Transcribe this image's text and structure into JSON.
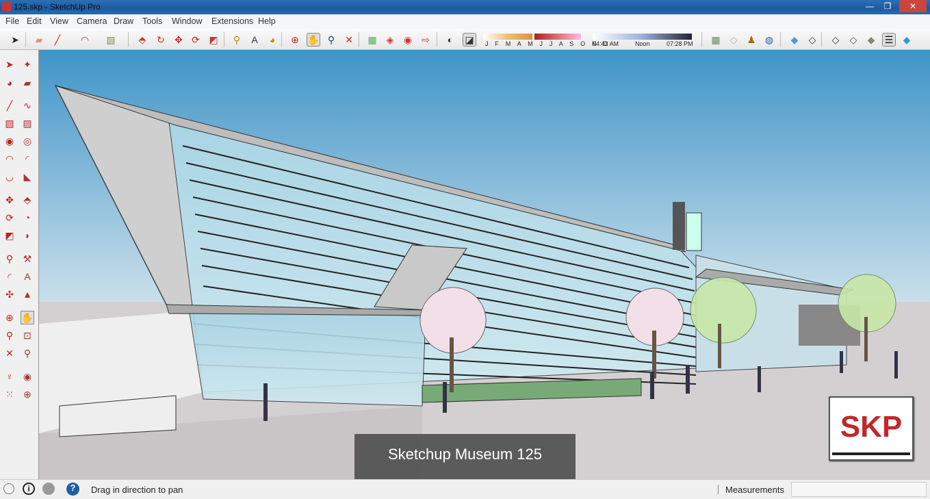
{
  "window": {
    "title": "125.skp - SketchUp Pro",
    "minimize": "—",
    "maximize": "❐",
    "close": "✕"
  },
  "menu": [
    "File",
    "Edit",
    "View",
    "Camera",
    "Draw",
    "Tools",
    "Window",
    "Extensions",
    "Help"
  ],
  "shadow": {
    "months": "J F M A M J J A S O N D",
    "time_start": "04:43 AM",
    "time_mid": "Noon",
    "time_end": "07:28 PM",
    "month_value": 7,
    "time_fraction": 0.05
  },
  "viewport": {
    "caption": "Sketchup Museum 125",
    "logo_text": "SKP"
  },
  "status": {
    "hint": "Drag in direction to pan",
    "measurements_label": "Measurements",
    "measurements_value": ""
  },
  "colors": {
    "sky_top": "#3f94c8",
    "sky_bottom": "#d6e6ee",
    "ground": "#d4d0d2",
    "logo_red": "#c0282c"
  }
}
